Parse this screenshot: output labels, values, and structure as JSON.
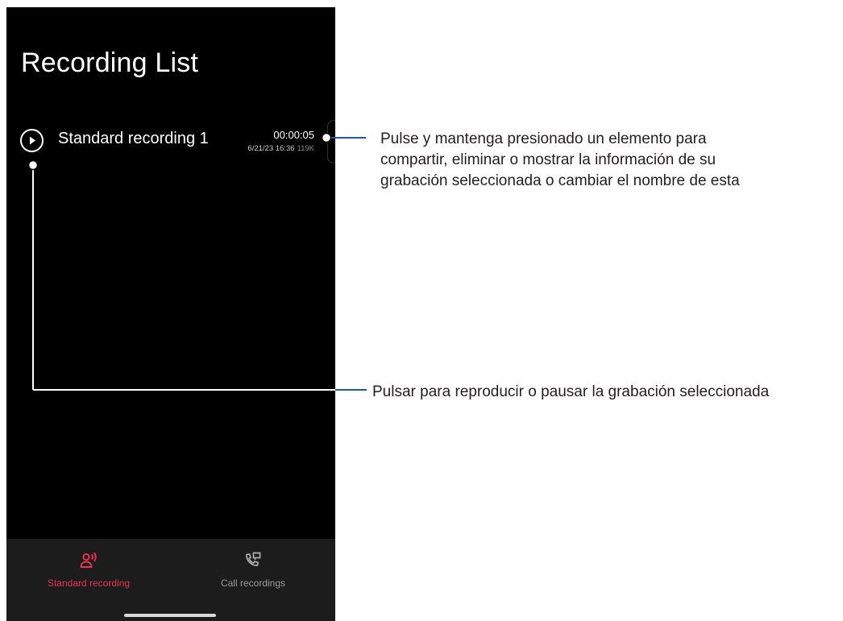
{
  "screen": {
    "title": "Recording List"
  },
  "recordings": [
    {
      "name": "Standard recording 1",
      "duration": "00:00:05",
      "date": "6/21/23 16:36",
      "size": "119K"
    }
  ],
  "bottom_nav": {
    "items": [
      {
        "label": "Standard recording",
        "icon": "standard-recording-icon",
        "active": true
      },
      {
        "label": "Call recordings",
        "icon": "call-recordings-icon",
        "active": false
      }
    ]
  },
  "annotations": {
    "item_menu": {
      "lines": [
        "Pulse y mantenga presionado un elemento para",
        "compartir, eliminar o mostrar la información de su",
        "grabación seleccionada o cambiar el nombre de esta"
      ]
    },
    "play": {
      "text": "Pulsar para reproducir o pausar la grabación seleccionada"
    }
  },
  "colors": {
    "accent": "#e8334f",
    "screen_bg": "#000000",
    "nav_bg": "#1c1c1c",
    "callout_line": "#1e5aa8",
    "annotation_text": "#231f20"
  }
}
